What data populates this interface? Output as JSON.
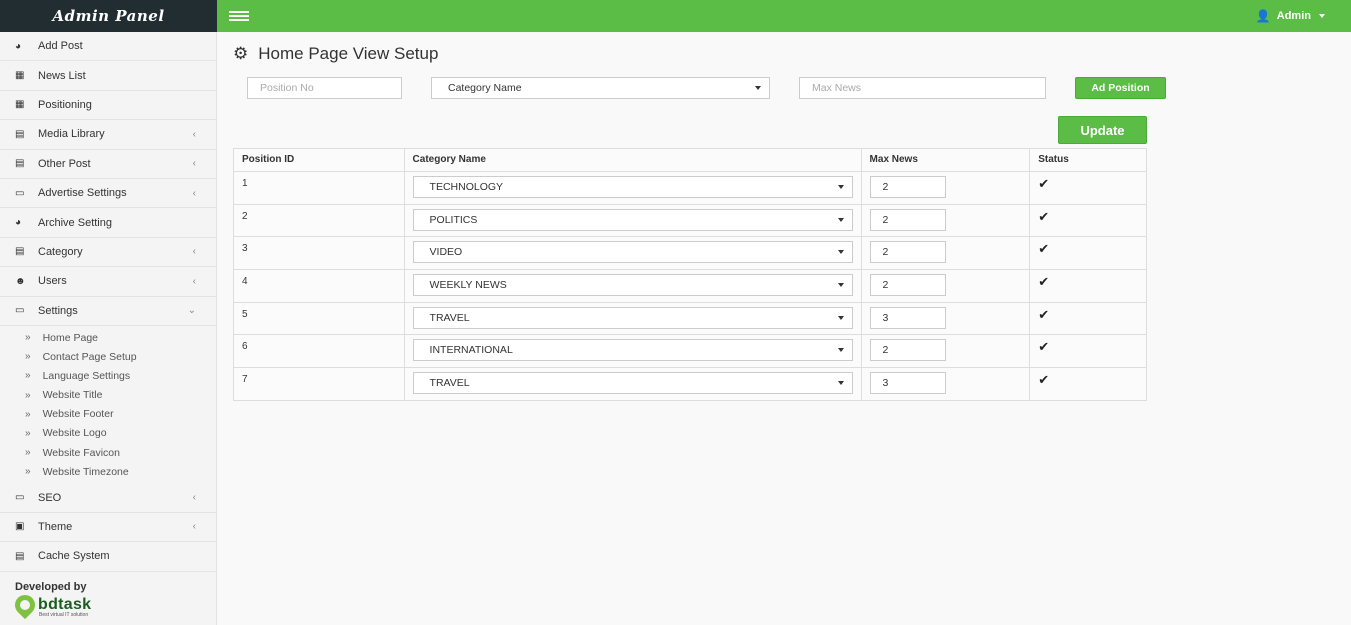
{
  "brand": {
    "title": "Admin Panel"
  },
  "topbar": {
    "user_label": "Admin"
  },
  "sidebar": {
    "items": [
      {
        "label": "Add Post",
        "icon": "dashboard-icon"
      },
      {
        "label": "News List",
        "icon": "grid-icon"
      },
      {
        "label": "Positioning",
        "icon": "grid-icon"
      },
      {
        "label": "Media Library",
        "icon": "chart-icon"
      },
      {
        "label": "Other Post",
        "icon": "chart-icon"
      },
      {
        "label": "Advertise Settings",
        "icon": "laptop-icon"
      },
      {
        "label": "Archive Setting",
        "icon": "dashboard-icon"
      },
      {
        "label": "Category",
        "icon": "chart-icon"
      },
      {
        "label": "Users",
        "icon": "user-icon"
      },
      {
        "label": "Settings",
        "icon": "laptop-icon"
      }
    ],
    "settings_sub": [
      "Home Page",
      "Contact Page Setup",
      "Language Settings",
      "Website Title",
      "Website Footer",
      "Website Logo",
      "Website Favicon",
      "Website Timezone"
    ],
    "items_after": [
      {
        "label": "SEO",
        "icon": "laptop-icon"
      },
      {
        "label": "Theme",
        "icon": "image-icon"
      },
      {
        "label": "Cache System",
        "icon": "chart-icon"
      }
    ],
    "developer": {
      "label": "Developed by",
      "company": "bdtask",
      "tagline": "Best virtual IT solution"
    }
  },
  "page": {
    "title": "Home Page View Setup"
  },
  "form": {
    "position_placeholder": "Position No",
    "category_selected": "Category Name",
    "max_news_placeholder": "Max News",
    "add_button": "Ad Position",
    "update_button": "Update"
  },
  "table": {
    "headers": [
      "Position ID",
      "Category Name",
      "Max News",
      "Status"
    ],
    "rows": [
      {
        "id": "1",
        "category": "TECHNOLOGY",
        "max": "2",
        "status": true
      },
      {
        "id": "2",
        "category": "POLITICS",
        "max": "2",
        "status": true
      },
      {
        "id": "3",
        "category": "VIDEO",
        "max": "2",
        "status": true
      },
      {
        "id": "4",
        "category": "WEEKLY NEWS",
        "max": "2",
        "status": true
      },
      {
        "id": "5",
        "category": "TRAVEL",
        "max": "3",
        "status": true
      },
      {
        "id": "6",
        "category": "INTERNATIONAL",
        "max": "2",
        "status": true
      },
      {
        "id": "7",
        "category": "TRAVEL",
        "max": "3",
        "status": true
      }
    ]
  },
  "colors": {
    "green": "#5bbc46",
    "dark": "#222d32"
  }
}
